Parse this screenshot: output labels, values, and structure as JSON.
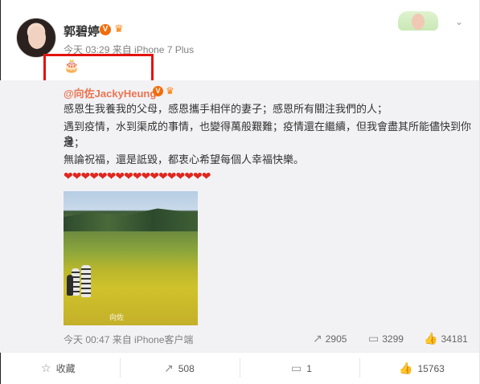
{
  "post": {
    "username": "郭碧婷",
    "verified_icon": "verified-badge-icon",
    "meta": "今天 03:29 来自 iPhone 7 Plus",
    "text": "🎂"
  },
  "repost": {
    "username": "@向佐JackyHeung",
    "lines": [
      "感恩生我養我的父母，感恩攜手相伴的妻子；感恩所有關注我們的人；",
      "遇到疫情，水到渠成的事情，也變得萬般艱難；疫情還在繼續，但我會盡其所能儘快到你身",
      "邊；",
      "無論祝福，還是詆毀，都衷心希望每個人幸福快樂。"
    ],
    "hearts": "❤❤❤❤❤❤❤❤❤❤❤❤❤❤❤❤❤",
    "image_watermark": "向佐",
    "meta": "今天 00:47 来自 iPhone客户端",
    "repost_count": "2905",
    "comment_count": "3299",
    "like_count": "34181"
  },
  "actions": {
    "favorite_label": "收藏",
    "repost_count": "508",
    "comment_count": "1",
    "like_count": "15763"
  },
  "colors": {
    "link": "#eb7350",
    "highlight_box": "#e3130e",
    "repost_bg": "#f2f2f5"
  }
}
